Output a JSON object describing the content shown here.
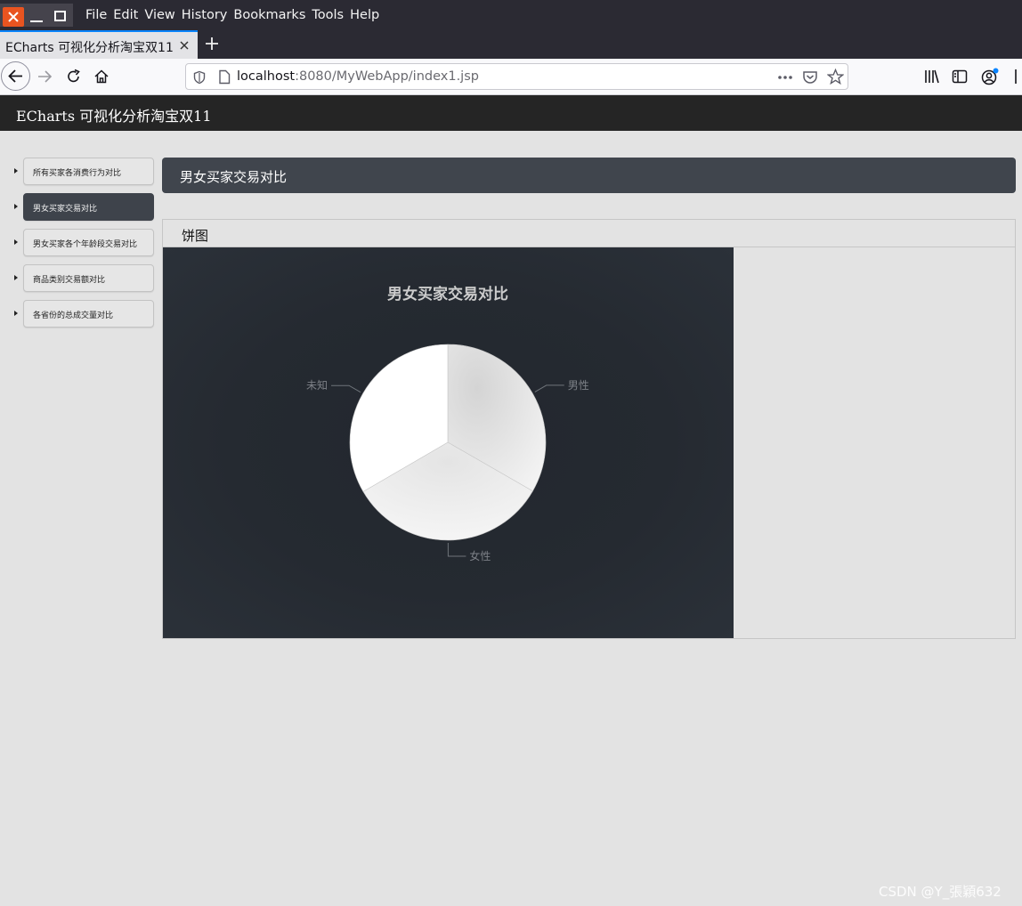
{
  "browser": {
    "menu": [
      "File",
      "Edit",
      "View",
      "History",
      "Bookmarks",
      "Tools",
      "Help"
    ],
    "tab_title": "ECharts 可视化分析淘宝双11",
    "url_host": "localhost",
    "url_rest": ":8080/MyWebApp/index1.jsp"
  },
  "header": {
    "title": "ECharts 可视化分析淘宝双11"
  },
  "sidebar": {
    "items": [
      {
        "label": "所有买家各消费行为对比",
        "active": false
      },
      {
        "label": "男女买家交易对比",
        "active": true
      },
      {
        "label": "男女买家各个年龄段交易对比",
        "active": false
      },
      {
        "label": "商品类别交易额对比",
        "active": false
      },
      {
        "label": "各省份的总成交量对比",
        "active": false
      }
    ]
  },
  "main": {
    "section_title": "男女买家交易对比",
    "panel_title": "饼图"
  },
  "chart_data": {
    "type": "pie",
    "title": "男女买家交易对比",
    "slices": [
      {
        "name": "男性",
        "value": 33.3
      },
      {
        "name": "女性",
        "value": 33.3
      },
      {
        "name": "未知",
        "value": 33.4
      }
    ]
  },
  "watermark": "CSDN @Y_張穎632"
}
